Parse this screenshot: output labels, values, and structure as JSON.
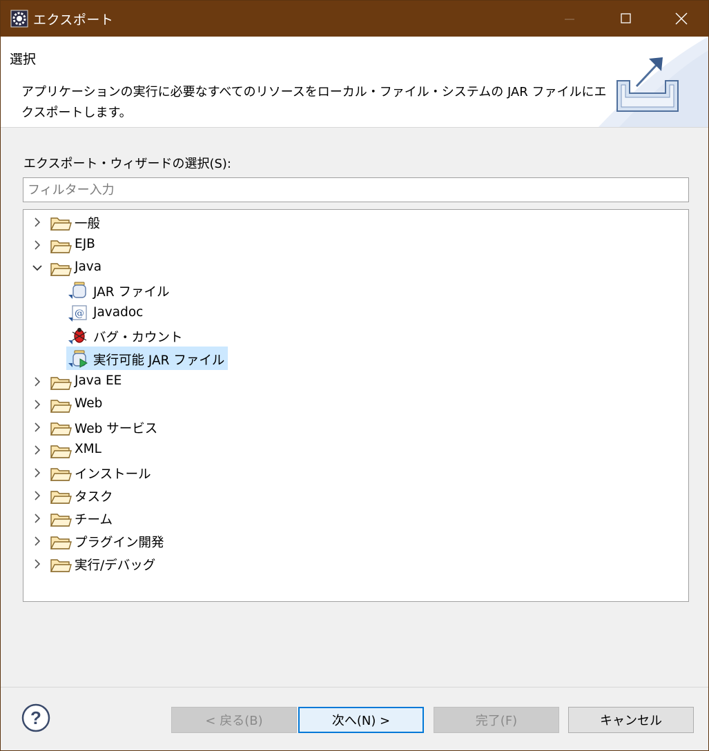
{
  "window": {
    "title": "エクスポート"
  },
  "header": {
    "title": "選択",
    "description": "アプリケーションの実行に必要なすべてのリソースをローカル・ファイル・システムの JAR ファイルにエクスポートします。"
  },
  "wizard": {
    "label": "エクスポート・ウィザードの選択(S):",
    "filter_placeholder": "フィルター入力"
  },
  "tree": {
    "items": [
      {
        "label": "一般",
        "type": "folder",
        "expanded": false
      },
      {
        "label": "EJB",
        "type": "folder",
        "expanded": false
      },
      {
        "label": "Java",
        "type": "folder",
        "expanded": true
      },
      {
        "label": "JAR ファイル",
        "type": "jar-icon",
        "child": true
      },
      {
        "label": "Javadoc",
        "type": "javadoc-icon",
        "child": true
      },
      {
        "label": "バグ・カウント",
        "type": "bug-icon",
        "child": true
      },
      {
        "label": "実行可能 JAR ファイル",
        "type": "runnable-jar-icon",
        "child": true,
        "selected": true
      },
      {
        "label": "Java EE",
        "type": "folder",
        "expanded": false
      },
      {
        "label": "Web",
        "type": "folder",
        "expanded": false
      },
      {
        "label": "Web サービス",
        "type": "folder",
        "expanded": false
      },
      {
        "label": "XML",
        "type": "folder",
        "expanded": false
      },
      {
        "label": "インストール",
        "type": "folder",
        "expanded": false
      },
      {
        "label": "タスク",
        "type": "folder",
        "expanded": false
      },
      {
        "label": "チーム",
        "type": "folder",
        "expanded": false
      },
      {
        "label": "プラグイン開発",
        "type": "folder",
        "expanded": false
      },
      {
        "label": "実行/デバッグ",
        "type": "folder",
        "expanded": false
      }
    ]
  },
  "buttons": {
    "back": "< 戻る(B)",
    "next": "次へ(N) >",
    "finish": "完了(F)",
    "cancel": "キャンセル"
  },
  "colors": {
    "titlebar": "#6b3a10",
    "selection": "#cce8ff",
    "default_button_border": "#0078d7"
  }
}
